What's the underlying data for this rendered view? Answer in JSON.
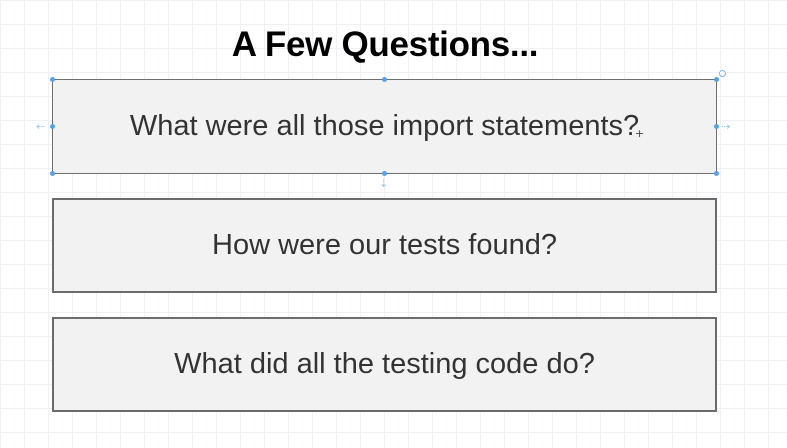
{
  "slide": {
    "title": "A Few Questions...",
    "questions": [
      "What were all those import statements?",
      "How were our tests found?",
      "What did all the testing code do?"
    ]
  },
  "selection": {
    "selected_index": 0,
    "handle_color": "#5aa0e6"
  },
  "icons": {
    "cursor": "crosshair-cursor-icon",
    "resize_left": "resize-left-arrow-icon",
    "resize_right": "resize-right-arrow-icon",
    "resize_bottom": "resize-down-arrow-icon",
    "rotate": "rotate-handle-icon"
  }
}
